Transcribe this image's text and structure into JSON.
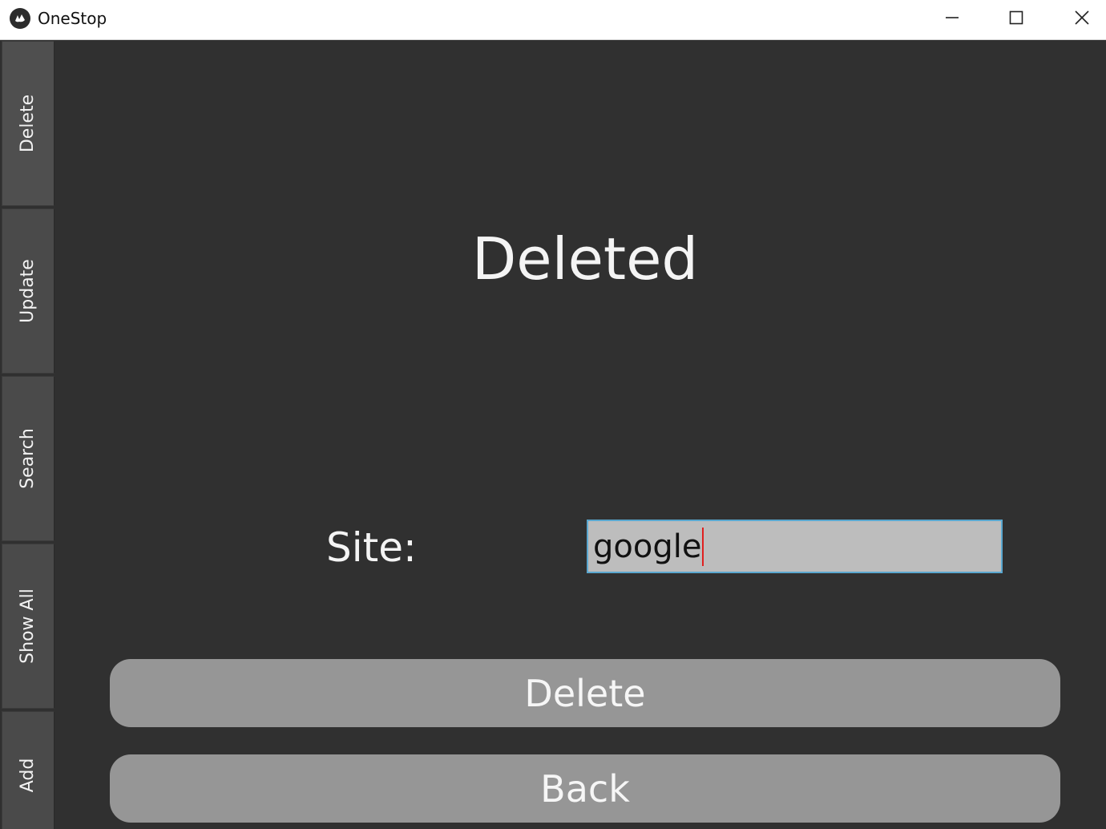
{
  "window": {
    "title": "OneStop"
  },
  "sidebar": {
    "tabs": [
      {
        "label": "Delete"
      },
      {
        "label": "Update"
      },
      {
        "label": "Search"
      },
      {
        "label": "Show All"
      },
      {
        "label": "Add"
      }
    ],
    "active_tab": "Delete"
  },
  "main": {
    "heading": "Deleted",
    "site_label": "Site:",
    "site_value": "google",
    "delete_label": "Delete",
    "back_label": "Back"
  },
  "colors": {
    "background": "#303030",
    "tab": "#4a4a4a",
    "button": "#969696",
    "input_bg": "#bdbdbd",
    "input_border": "#5aa7cf",
    "caret": "#e0201f"
  },
  "icons": {
    "app": "kivy-logo-icon",
    "minimize": "minimize-icon",
    "maximize": "maximize-icon",
    "close": "close-icon"
  }
}
